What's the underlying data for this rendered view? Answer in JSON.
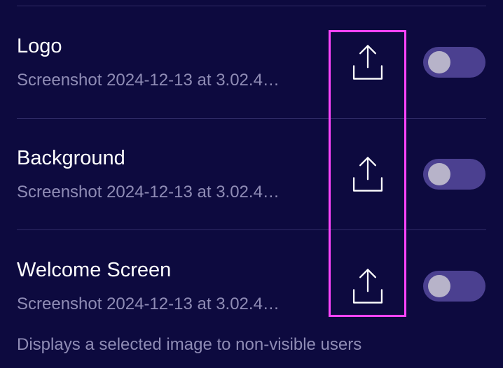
{
  "settings": {
    "items": [
      {
        "title": "Logo",
        "filename": "Screenshot 2024-12-13 at 3.02.4…",
        "upload_icon": "upload-icon",
        "toggle_on": false
      },
      {
        "title": "Background",
        "filename": "Screenshot 2024-12-13 at 3.02.4…",
        "upload_icon": "upload-icon",
        "toggle_on": false
      },
      {
        "title": "Welcome Screen",
        "filename": "Screenshot 2024-12-13 at 3.02.4…",
        "upload_icon": "upload-icon",
        "toggle_on": false
      }
    ],
    "footnote": "Displays a selected image to non-visible users"
  },
  "colors": {
    "background": "#0d0a3f",
    "divider": "#2f2b66",
    "title_text": "#ffffff",
    "subtitle_text": "#8f8cb5",
    "toggle_track": "#4b4090",
    "toggle_knob": "#b7b3c9",
    "highlight": "#ff44ff"
  }
}
